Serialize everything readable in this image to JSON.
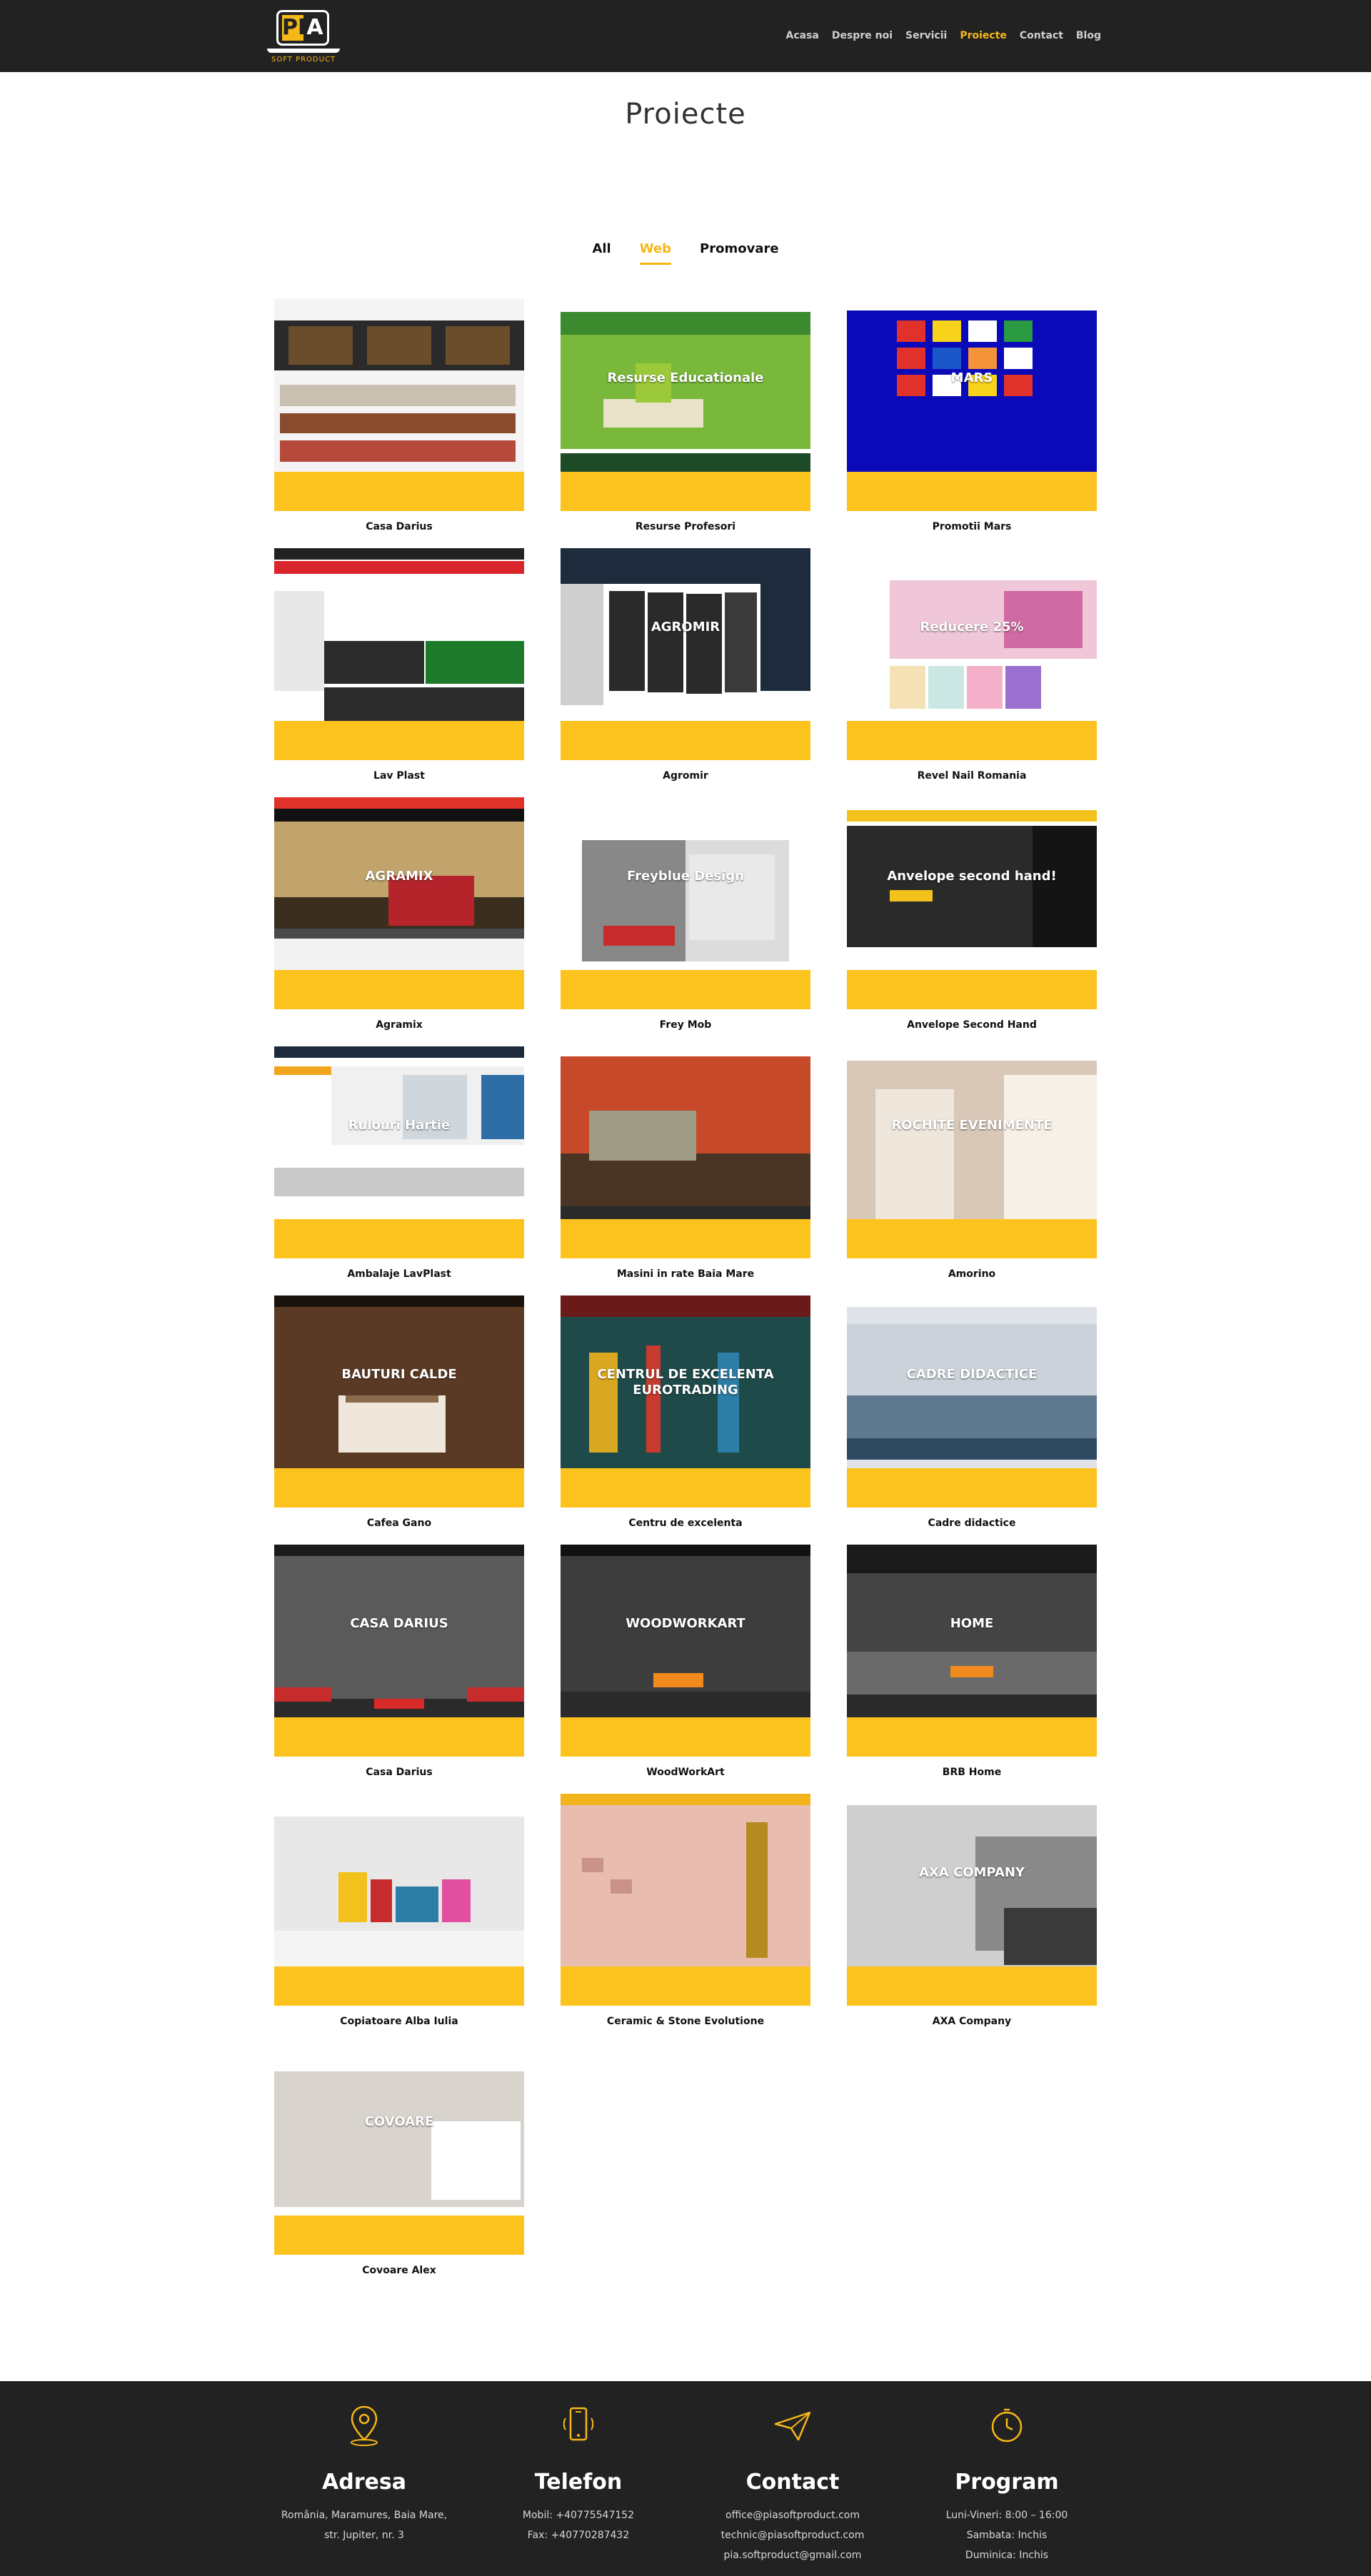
{
  "header": {
    "logo_letters_pi": "PI",
    "logo_letters_a": "A",
    "logo_sub": "SOFT PRODUCT",
    "nav": [
      "Acasa",
      "Despre noi",
      "Servicii",
      "Proiecte",
      "Contact",
      "Blog"
    ],
    "active_nav": "Proiecte"
  },
  "page": {
    "title": "Proiecte"
  },
  "filters": [
    "All",
    "Web",
    "Promovare"
  ],
  "active_filter": "Web",
  "colors": {
    "accent": "#fcc31e",
    "header_bg": "#222222",
    "footer_bg": "#222222",
    "nav_active": "#f6b817"
  },
  "projects": [
    {
      "title": "Casa Darius",
      "scene": "furniture"
    },
    {
      "title": "Resurse Profesori",
      "scene": "apple",
      "overlay": "Resurse Educationale"
    },
    {
      "title": "Promotii Mars",
      "scene": "mars",
      "overlay": "MARS"
    },
    {
      "title": "Lav Plast",
      "scene": "tools"
    },
    {
      "title": "Agromir",
      "scene": "tires",
      "overlay": "AGROMIR"
    },
    {
      "title": "Revel Nail Romania",
      "scene": "nails",
      "overlay": "Reducere 25%"
    },
    {
      "title": "Agramix",
      "scene": "tractor",
      "overlay": "AGRAMIX"
    },
    {
      "title": "Frey Mob",
      "scene": "interior",
      "overlay": "Freyblue Design"
    },
    {
      "title": "Anvelope Second Hand",
      "scene": "tire2",
      "overlay": "Anvelope second hand!"
    },
    {
      "title": "Ambalaje LavPlast",
      "scene": "packaging",
      "overlay": "Rulouri Hartie"
    },
    {
      "title": "Masini in rate Baia Mare",
      "scene": "car"
    },
    {
      "title": "Amorino",
      "scene": "girls",
      "overlay": "ROCHITE EVENIMENTE"
    },
    {
      "title": "Cafea Gano",
      "scene": "coffee",
      "overlay": "BAUTURI CALDE"
    },
    {
      "title": "Centru de excelenta",
      "scene": "pencils",
      "overlay": "CENTRUL DE EXCELENTA EUROTRADING"
    },
    {
      "title": "Cadre didactice",
      "scene": "lake",
      "overlay": "CADRE DIDACTICE"
    },
    {
      "title": "Casa Darius",
      "scene": "casa",
      "overlay": "CASA DARIUS"
    },
    {
      "title": "WoodWorkArt",
      "scene": "wood",
      "overlay": "WOODWORKART"
    },
    {
      "title": "BRB Home",
      "scene": "home",
      "overlay": "HOME"
    },
    {
      "title": "Copiatoare Alba Iulia",
      "scene": "books"
    },
    {
      "title": "Ceramic & Stone Evolutione",
      "scene": "ceramic"
    },
    {
      "title": "AXA Company",
      "scene": "axa",
      "overlay": "AXA COMPANY"
    },
    {
      "title": "Covoare Alex",
      "scene": "carpet",
      "overlay": "COVOARE"
    }
  ],
  "footer": {
    "address": {
      "heading": "Adresa",
      "lines": [
        "România, Maramures, Baia Mare,",
        "str. Jupiter, nr. 3"
      ]
    },
    "phone": {
      "heading": "Telefon",
      "lines": [
        "Mobil: +40775547152",
        "Fax: +40770287432"
      ]
    },
    "contact": {
      "heading": "Contact",
      "lines": [
        "office@piasoftproduct.com",
        "technic@piasoftproduct.com",
        "pia.softproduct@gmail.com"
      ]
    },
    "program": {
      "heading": "Program",
      "lines": [
        "Luni-Vineri: 8:00 – 16:00",
        "Sambata: Inchis",
        "Duminica: Inchis"
      ]
    }
  }
}
